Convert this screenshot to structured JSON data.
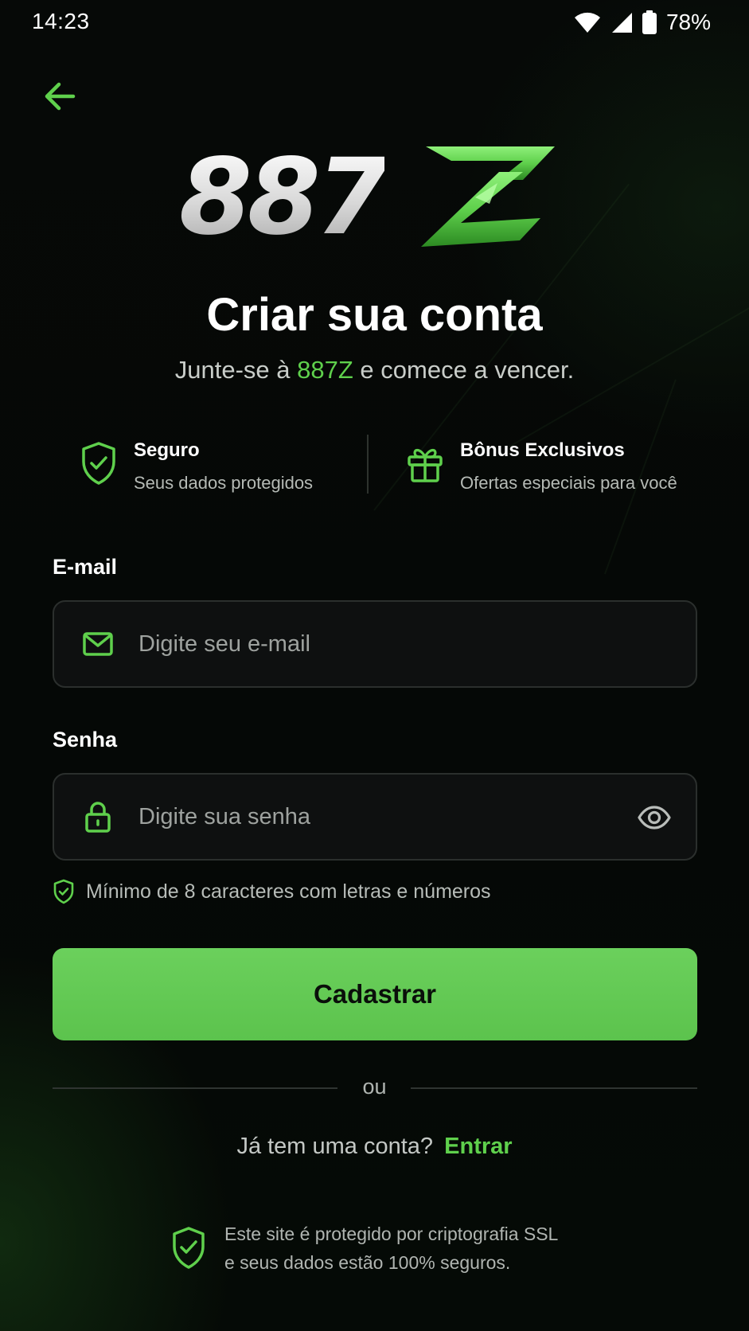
{
  "status_bar": {
    "time": "14:23",
    "battery": "78%"
  },
  "logo": {
    "text_main": "887",
    "text_accent": "Z"
  },
  "header": {
    "title": "Criar sua conta",
    "subtitle_prefix": "Junte-se à ",
    "subtitle_brand": "887Z",
    "subtitle_suffix": " e comece a vencer."
  },
  "features": [
    {
      "title": "Seguro",
      "desc": "Seus dados protegidos",
      "icon": "shield-check-icon"
    },
    {
      "title": "Bônus Exclusivos",
      "desc": "Ofertas especiais para você",
      "icon": "gift-icon"
    }
  ],
  "form": {
    "email_label": "E-mail",
    "email_placeholder": "Digite seu e-mail",
    "email_value": "",
    "password_label": "Senha",
    "password_placeholder": "Digite sua senha",
    "password_value": "",
    "password_hint": "Mínimo de 8 caracteres com letras e números",
    "submit_label": "Cadastrar"
  },
  "divider_text": "ou",
  "login": {
    "prompt": "Já tem uma conta?",
    "link": "Entrar"
  },
  "ssl": {
    "line1": "Este site é protegido por criptografia SSL",
    "line2": "e seus dados estão 100% seguros."
  },
  "colors": {
    "accent": "#5fd04c",
    "background": "#050806",
    "button": "#64c955"
  }
}
